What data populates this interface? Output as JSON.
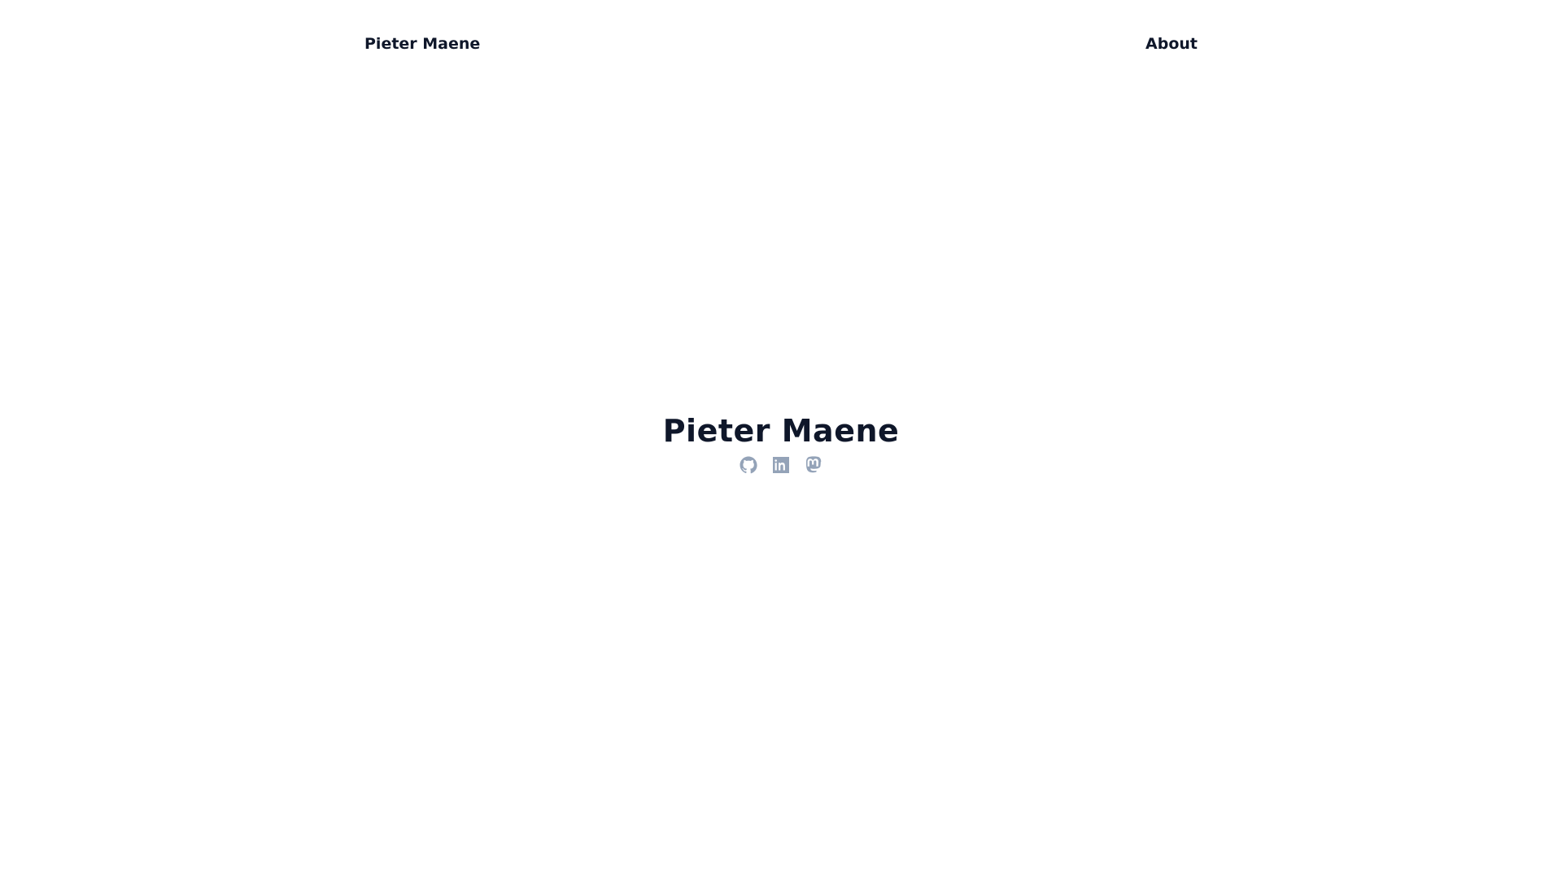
{
  "header": {
    "site_title": "Pieter Maene",
    "nav": [
      {
        "label": "About"
      }
    ]
  },
  "hero": {
    "name": "Pieter Maene",
    "social_links": [
      {
        "icon": "github-icon"
      },
      {
        "icon": "linkedin-icon"
      },
      {
        "icon": "mastodon-icon"
      }
    ],
    "icon_color": "#94a3b8"
  },
  "colors": {
    "text": "#0f172a",
    "background": "#ffffff",
    "icon": "#94a3b8"
  }
}
